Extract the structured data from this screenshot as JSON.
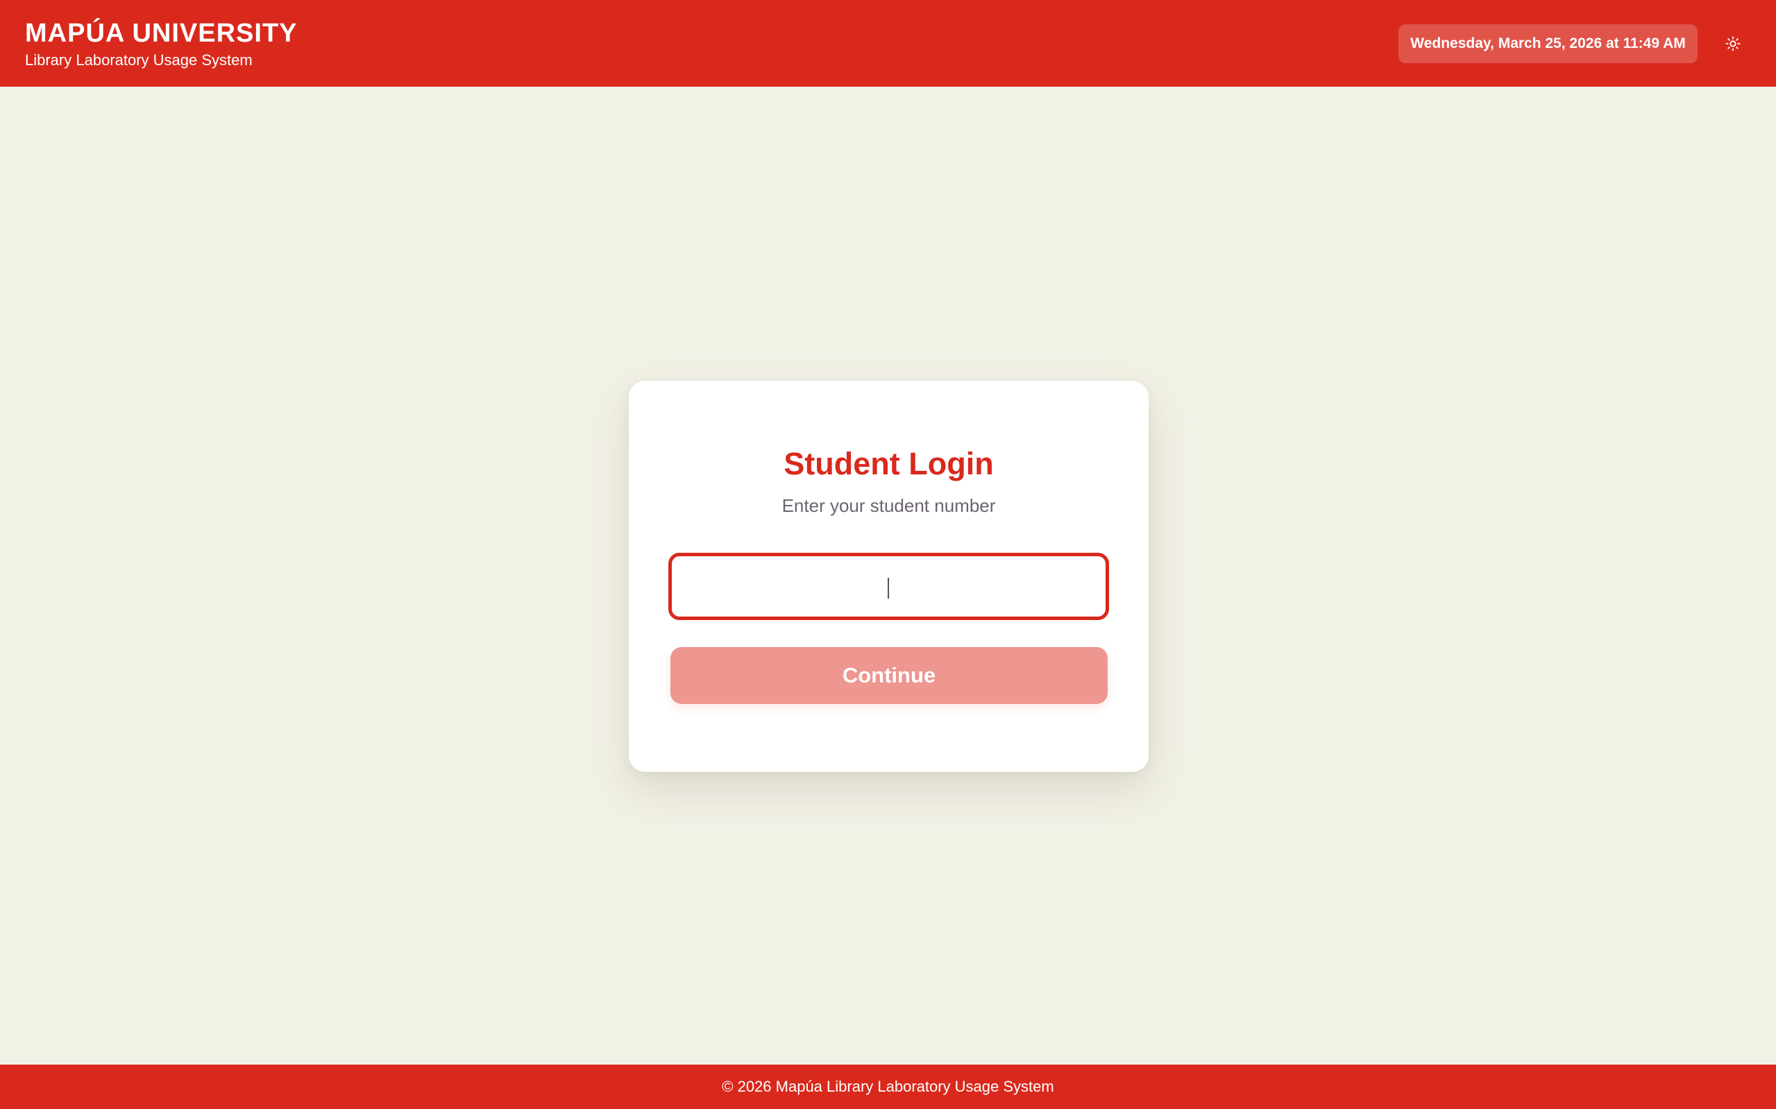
{
  "header": {
    "title": "MAPÚA UNIVERSITY",
    "subtitle": "Library Laboratory Usage System",
    "datetime": "Wednesday, March 25, 2026 at 11:49 AM",
    "theme_toggle_icon": "sun-icon"
  },
  "login": {
    "title": "Student Login",
    "subtitle": "Enter your student number",
    "student_number_value": "",
    "continue_label": "Continue"
  },
  "footer": {
    "text": "© 2026 Mapúa Library Laboratory Usage System"
  },
  "colors": {
    "brand_red": "#d9291c",
    "background": "#f2f1e6",
    "button_disabled": "#ee9690",
    "subtitle_gray": "#6b6470"
  }
}
